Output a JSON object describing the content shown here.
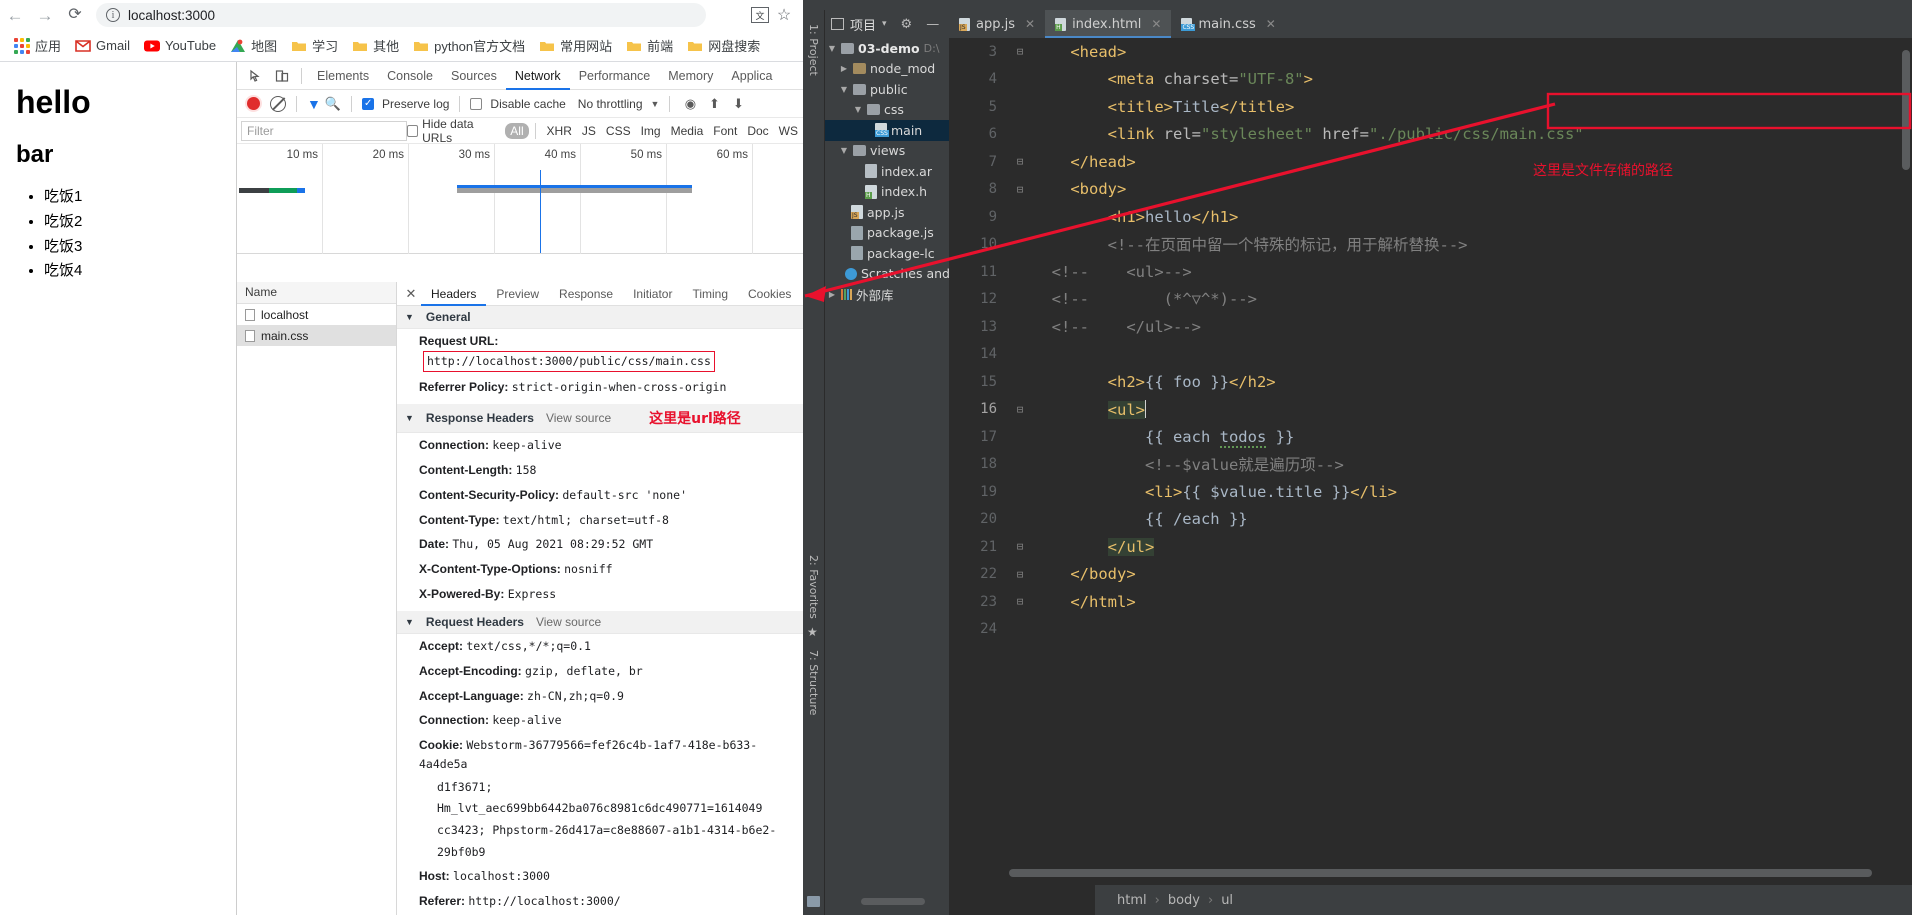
{
  "browser": {
    "nav": {
      "back": "←",
      "forward": "→",
      "reload": "⟳"
    },
    "omnibox": {
      "info_icon": "ⓘ",
      "url": "localhost:3000"
    },
    "toolbar_right": {
      "translate_icon": "translate-icon",
      "star_icon": "☆"
    },
    "bookmarks": [
      {
        "label": "应用",
        "icon": "apps-grid-icon"
      },
      {
        "label": "Gmail",
        "icon": "gmail-icon"
      },
      {
        "label": "YouTube",
        "icon": "youtube-icon"
      },
      {
        "label": "地图",
        "icon": "maps-icon"
      },
      {
        "label": "学习",
        "icon": "folder-icon"
      },
      {
        "label": "其他",
        "icon": "folder-icon"
      },
      {
        "label": "python官方文档",
        "icon": "folder-icon"
      },
      {
        "label": "常用网站",
        "icon": "folder-icon"
      },
      {
        "label": "前端",
        "icon": "folder-icon"
      },
      {
        "label": "网盘搜索",
        "icon": "folder-icon"
      }
    ]
  },
  "page": {
    "h1": "hello",
    "h2": "bar",
    "list": [
      "吃饭1",
      "吃饭2",
      "吃饭3",
      "吃饭4"
    ]
  },
  "devtools": {
    "tabs": [
      {
        "label": "Elements",
        "active": false
      },
      {
        "label": "Console",
        "active": false
      },
      {
        "label": "Sources",
        "active": false
      },
      {
        "label": "Network",
        "active": true
      },
      {
        "label": "Performance",
        "active": false
      },
      {
        "label": "Memory",
        "active": false
      },
      {
        "label": "Applica",
        "active": false
      }
    ],
    "toolbar": {
      "record_icon": "record-icon",
      "clear_icon": "clear-icon",
      "filter_icon": "funnel-icon",
      "search_icon": "search-icon",
      "preserve_log": "Preserve log",
      "preserve_log_checked": true,
      "disable_cache": "Disable cache",
      "disable_cache_checked": false,
      "throttling": "No throttling"
    },
    "filterbar": {
      "filter_placeholder": "Filter",
      "hide_data_urls": "Hide data URLs",
      "hide_data_urls_checked": false,
      "types": [
        "All",
        "XHR",
        "JS",
        "CSS",
        "Img",
        "Media",
        "Font",
        "Doc",
        "WS"
      ],
      "selected_type": "All"
    },
    "timeline": {
      "ticks": [
        "10 ms",
        "20 ms",
        "30 ms",
        "40 ms",
        "50 ms",
        "60 ms"
      ]
    },
    "requests": {
      "column_header": "Name",
      "rows": [
        {
          "name": "localhost",
          "selected": false
        },
        {
          "name": "main.css",
          "selected": true
        }
      ]
    },
    "detail_tabs": [
      {
        "label": "Headers",
        "active": true
      },
      {
        "label": "Preview",
        "active": false
      },
      {
        "label": "Response",
        "active": false
      },
      {
        "label": "Initiator",
        "active": false
      },
      {
        "label": "Timing",
        "active": false
      },
      {
        "label": "Cookies",
        "active": false
      }
    ],
    "sections": {
      "general": {
        "title": "General",
        "rows": [
          {
            "key": "Request URL",
            "value": "http://localhost:3000/public/css/main.css",
            "boxed": true
          },
          {
            "key": "Referrer Policy",
            "value": "strict-origin-when-cross-origin",
            "boxed": false
          }
        ]
      },
      "response_headers": {
        "title": "Response Headers",
        "view_source": "View source",
        "rows": [
          {
            "key": "Connection",
            "value": "keep-alive"
          },
          {
            "key": "Content-Length",
            "value": "158"
          },
          {
            "key": "Content-Security-Policy",
            "value": "default-src 'none'"
          },
          {
            "key": "Content-Type",
            "value": "text/html; charset=utf-8"
          },
          {
            "key": "Date",
            "value": "Thu, 05 Aug 2021 08:29:52 GMT"
          },
          {
            "key": "X-Content-Type-Options",
            "value": "nosniff"
          },
          {
            "key": "X-Powered-By",
            "value": "Express"
          }
        ]
      },
      "request_headers": {
        "title": "Request Headers",
        "view_source": "View source",
        "rows": [
          {
            "key": "Accept",
            "value": "text/css,*/*;q=0.1"
          },
          {
            "key": "Accept-Encoding",
            "value": "gzip, deflate, br"
          },
          {
            "key": "Accept-Language",
            "value": "zh-CN,zh;q=0.9"
          },
          {
            "key": "Connection",
            "value": "keep-alive"
          },
          {
            "key": "Cookie",
            "value": "Webstorm-36779566=fef26c4b-1af7-418e-b633-4a4de5a"
          },
          {
            "key": "Host",
            "value": "localhost:3000"
          },
          {
            "key": "Referer",
            "value": "http://localhost:3000/"
          }
        ],
        "cookie_continuations": [
          "d1f3671; Hm_lvt_aec699bb6442ba076c8981c6dc490771=1614049",
          "cc3423; Phpstorm-26d417a=c8e88607-a1b1-4314-b6e2-29bf0b9"
        ]
      }
    }
  },
  "ide": {
    "left_strip": {
      "project": "1: Project",
      "favorites": "2: Favorites",
      "structure": "7: Structure",
      "star_icon": "★"
    },
    "project_header": {
      "label": "项目",
      "caret": "▾",
      "gear_icon": "⚙",
      "minimize_icon": "—"
    },
    "tree": [
      {
        "label": "03-demo",
        "suffix": "D:\\",
        "indent": 0,
        "twisty": "▼",
        "icon": "folder",
        "bold": true
      },
      {
        "label": "node_mod",
        "indent": 1,
        "twisty": "▶",
        "icon": "folder-tan"
      },
      {
        "label": "public",
        "indent": 1,
        "twisty": "▼",
        "icon": "folder"
      },
      {
        "label": "css",
        "indent": 2,
        "twisty": "▼",
        "icon": "folder"
      },
      {
        "label": "main",
        "indent": 3,
        "twisty": "",
        "icon": "css-file",
        "selected": true
      },
      {
        "label": "views",
        "indent": 1,
        "twisty": "▼",
        "icon": "folder"
      },
      {
        "label": "index.ar",
        "indent": 2,
        "twisty": "",
        "icon": "txt-file"
      },
      {
        "label": "index.h",
        "indent": 2,
        "twisty": "",
        "icon": "html-file"
      },
      {
        "label": "app.js",
        "indent": 1,
        "twisty": "",
        "icon": "js-file"
      },
      {
        "label": "package.js",
        "indent": 1,
        "twisty": "",
        "icon": "json-file"
      },
      {
        "label": "package-lc",
        "indent": 1,
        "twisty": "",
        "icon": "json-file"
      },
      {
        "label": "Scratches and",
        "indent": 0,
        "twisty": "",
        "icon": "scratch"
      },
      {
        "label": "外部库",
        "indent": 0,
        "twisty": "▶",
        "icon": "library"
      }
    ],
    "editor_tabs": [
      {
        "label": "app.js",
        "badge": "JS",
        "badge_color": "#d8a657",
        "active": false
      },
      {
        "label": "index.html",
        "badge": "H",
        "badge_color": "#5b9c4a",
        "active": true
      },
      {
        "label": "main.css",
        "badge": "CSS",
        "badge_color": "#3c9bd6",
        "active": false
      }
    ],
    "code_lines": [
      {
        "num": "3",
        "fold": "⊟",
        "parts": [
          {
            "t": "    ",
            "c": "plain"
          },
          {
            "t": "<head>",
            "c": "tag"
          }
        ]
      },
      {
        "num": "4",
        "fold": "",
        "parts": [
          {
            "t": "        ",
            "c": "plain"
          },
          {
            "t": "<meta ",
            "c": "tag"
          },
          {
            "t": "charset=",
            "c": "attr"
          },
          {
            "t": "\"UTF-8\"",
            "c": "str"
          },
          {
            "t": ">",
            "c": "tag"
          }
        ]
      },
      {
        "num": "5",
        "fold": "",
        "parts": [
          {
            "t": "        ",
            "c": "plain"
          },
          {
            "t": "<title>",
            "c": "tag"
          },
          {
            "t": "Title",
            "c": "plain"
          },
          {
            "t": "</title>",
            "c": "tag"
          }
        ]
      },
      {
        "num": "6",
        "fold": "",
        "parts": [
          {
            "t": "        ",
            "c": "plain"
          },
          {
            "t": "<link ",
            "c": "tag"
          },
          {
            "t": "rel=",
            "c": "attr"
          },
          {
            "t": "\"stylesheet\"",
            "c": "str"
          },
          {
            "t": " ",
            "c": "plain"
          },
          {
            "t": "href=",
            "c": "attr"
          },
          {
            "t": "\"./public/css/main.css\"",
            "c": "str"
          }
        ]
      },
      {
        "num": "7",
        "fold": "⊟",
        "parts": [
          {
            "t": "    ",
            "c": "plain"
          },
          {
            "t": "</head>",
            "c": "tag"
          }
        ]
      },
      {
        "num": "8",
        "fold": "⊟",
        "parts": [
          {
            "t": "    ",
            "c": "plain"
          },
          {
            "t": "<body>",
            "c": "tag"
          }
        ]
      },
      {
        "num": "9",
        "fold": "",
        "parts": [
          {
            "t": "        ",
            "c": "plain"
          },
          {
            "t": "<h1>",
            "c": "tag"
          },
          {
            "t": "hello",
            "c": "plain"
          },
          {
            "t": "</h1>",
            "c": "tag"
          }
        ]
      },
      {
        "num": "10",
        "fold": "",
        "parts": [
          {
            "t": "        ",
            "c": "plain"
          },
          {
            "t": "<!--在页面中留一个特殊的标记，用于解析替换-->",
            "c": "cmt"
          }
        ]
      },
      {
        "num": "11",
        "fold": "",
        "parts": [
          {
            "t": "  ",
            "c": "plain"
          },
          {
            "t": "<!--    <ul>-->",
            "c": "cmt"
          }
        ]
      },
      {
        "num": "12",
        "fold": "",
        "parts": [
          {
            "t": "  ",
            "c": "plain"
          },
          {
            "t": "<!--        (*^▽^*)-->",
            "c": "cmt"
          }
        ]
      },
      {
        "num": "13",
        "fold": "",
        "parts": [
          {
            "t": "  ",
            "c": "plain"
          },
          {
            "t": "<!--    </ul>-->",
            "c": "cmt"
          }
        ]
      },
      {
        "num": "14",
        "fold": "",
        "parts": []
      },
      {
        "num": "15",
        "fold": "",
        "parts": [
          {
            "t": "        ",
            "c": "plain"
          },
          {
            "t": "<h2>",
            "c": "tag"
          },
          {
            "t": "{{ foo }}",
            "c": "plain"
          },
          {
            "t": "</h2>",
            "c": "tag"
          }
        ]
      },
      {
        "num": "16",
        "fold": "⊟",
        "current": true,
        "parts": [
          {
            "t": "        ",
            "c": "plain"
          },
          {
            "t": "<ul>",
            "c": "tag hl"
          }
        ]
      },
      {
        "num": "17",
        "fold": "",
        "parts": [
          {
            "t": "            ",
            "c": "plain"
          },
          {
            "t": "{{ each ",
            "c": "plain"
          },
          {
            "t": "todos",
            "c": "plain squiggle"
          },
          {
            "t": " }}",
            "c": "plain"
          }
        ]
      },
      {
        "num": "18",
        "fold": "",
        "parts": [
          {
            "t": "            ",
            "c": "plain"
          },
          {
            "t": "<!--$value就是遍历项-->",
            "c": "cmt"
          }
        ]
      },
      {
        "num": "19",
        "fold": "",
        "parts": [
          {
            "t": "            ",
            "c": "plain"
          },
          {
            "t": "<li>",
            "c": "tag"
          },
          {
            "t": "{{ $value.title }}",
            "c": "plain"
          },
          {
            "t": "</li>",
            "c": "tag"
          }
        ]
      },
      {
        "num": "20",
        "fold": "",
        "parts": [
          {
            "t": "            ",
            "c": "plain"
          },
          {
            "t": "{{ /each }}",
            "c": "plain"
          }
        ]
      },
      {
        "num": "21",
        "fold": "⊟",
        "parts": [
          {
            "t": "        ",
            "c": "plain"
          },
          {
            "t": "</ul>",
            "c": "tag hl"
          }
        ]
      },
      {
        "num": "22",
        "fold": "⊟",
        "parts": [
          {
            "t": "    ",
            "c": "plain"
          },
          {
            "t": "</body>",
            "c": "tag"
          }
        ]
      },
      {
        "num": "23",
        "fold": "⊟",
        "parts": [
          {
            "t": "    ",
            "c": "plain"
          },
          {
            "t": "</html>",
            "c": "tag"
          }
        ]
      },
      {
        "num": "24",
        "fold": "",
        "parts": []
      }
    ],
    "status_breadcrumb": [
      "html",
      "body",
      "ul"
    ]
  },
  "annotations": {
    "file_path_note": "这里是文件存储的路径",
    "url_path_note": "这里是url路径",
    "color": "#e8112d"
  }
}
